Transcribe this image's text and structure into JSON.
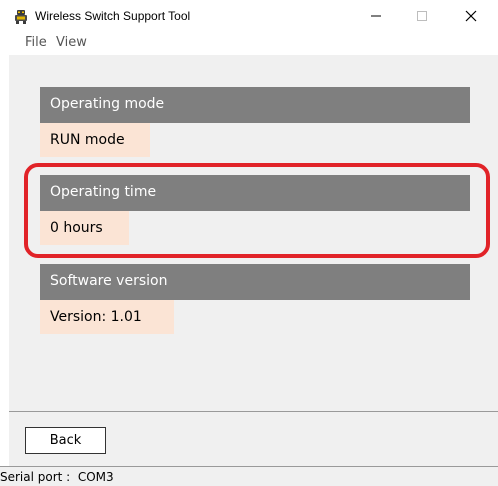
{
  "window": {
    "title": "Wireless Switch Support Tool",
    "icon": "robot-app-icon",
    "controls": {
      "minimize": "minimize-icon",
      "maximize": "maximize-icon",
      "close": "close-icon"
    }
  },
  "menu": {
    "items": [
      {
        "label": "File"
      },
      {
        "label": "View"
      }
    ]
  },
  "sections": {
    "operating_mode": {
      "header": "Operating mode",
      "value": "RUN mode"
    },
    "operating_time": {
      "header": "Operating time",
      "value": "0 hours"
    },
    "software_version": {
      "header": "Software version",
      "value": "Version: 1.01"
    }
  },
  "buttons": {
    "back": "Back"
  },
  "status": {
    "serial_port": "Serial port :  COM3"
  },
  "colors": {
    "header_bg": "#7f7f7f",
    "value_bg": "#fbe4d5",
    "highlight": "#e12328",
    "client_bg": "#f0f0f0"
  }
}
